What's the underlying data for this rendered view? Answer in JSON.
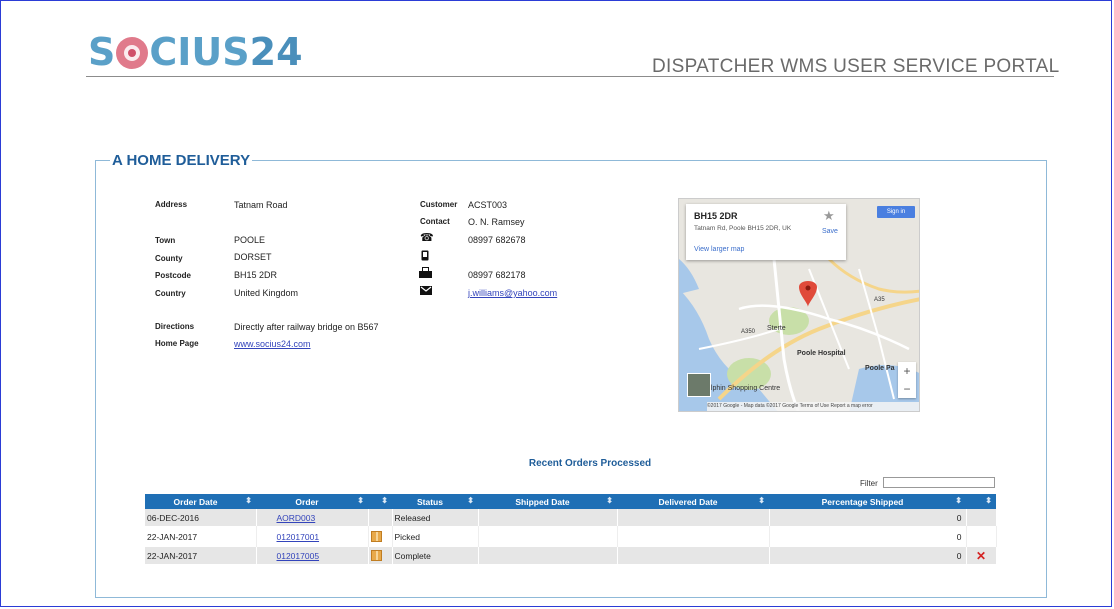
{
  "header": {
    "logo_prefix": "S",
    "logo_suffix": "CIUS",
    "logo_number": "24",
    "portal_title": "DISPATCHER WMS USER SERVICE PORTAL"
  },
  "delivery": {
    "title": "A HOME DELIVERY",
    "address": {
      "address_label": "Address",
      "address_value": "Tatnam Road",
      "town_label": "Town",
      "town_value": "POOLE",
      "county_label": "County",
      "county_value": "DORSET",
      "postcode_label": "Postcode",
      "postcode_value": "BH15 2DR",
      "country_label": "Country",
      "country_value": "United Kingdom",
      "directions_label": "Directions",
      "directions_value": "Directly after railway bridge on B567",
      "homepage_label": "Home Page",
      "homepage_value": "www.socius24.com"
    },
    "contact": {
      "customer_label": "Customer",
      "customer_value": "ACST003",
      "contact_label": "Contact",
      "contact_value": "O. N. Ramsey",
      "phone_value": "08997 682678",
      "mobile_value": "",
      "fax_value": "08997 682178",
      "email_value": "j.williams@yahoo.com"
    }
  },
  "map": {
    "postcode": "BH15 2DR",
    "address": "Tatnam Rd, Poole BH15 2DR, UK",
    "view_larger": "View larger map",
    "save": "Save",
    "sign_in": "Sign in",
    "zoom_in": "+",
    "zoom_out": "−",
    "labels": {
      "poole_hospital": "Poole Hospital",
      "poole_park": "Poole Pa",
      "dolphin": "olphin Shopping Centre",
      "sterte": "Sterte",
      "a35": "A35",
      "a350": "A350"
    },
    "footer": "©2017 Google - Map data ©2017 Google    Terms of Use    Report a map error"
  },
  "orders": {
    "section_title": "Recent Orders Processed",
    "filter_label": "Filter",
    "filter_value": "",
    "columns": [
      "Order Date",
      "Order",
      "",
      "Status",
      "Shipped Date",
      "Delivered Date",
      "Percentage Shipped",
      ""
    ],
    "rows": [
      {
        "order_date": "06-DEC-2016",
        "order": "AORD003",
        "status": "Released",
        "shipped_date": "",
        "delivered_date": "",
        "percentage": "0",
        "box": false,
        "deletable": false
      },
      {
        "order_date": "22-JAN-2017",
        "order": "012017001",
        "status": "Picked",
        "shipped_date": "",
        "delivered_date": "",
        "percentage": "0",
        "box": true,
        "deletable": false
      },
      {
        "order_date": "22-JAN-2017",
        "order": "012017005",
        "status": "Complete",
        "shipped_date": "",
        "delivered_date": "",
        "percentage": "0",
        "box": true,
        "deletable": true
      }
    ]
  },
  "colors": {
    "frame_border": "#2b3cd6",
    "brand_blue": "#5aa0c8",
    "logo_pink": "#e07a8b",
    "table_header": "#1f6fb5",
    "section_title": "#1f5d99",
    "delete": "#d42222"
  },
  "icons": {
    "phone": "phone-icon",
    "mobile": "mobile-icon",
    "fax": "fax-icon",
    "email": "envelope-icon"
  }
}
